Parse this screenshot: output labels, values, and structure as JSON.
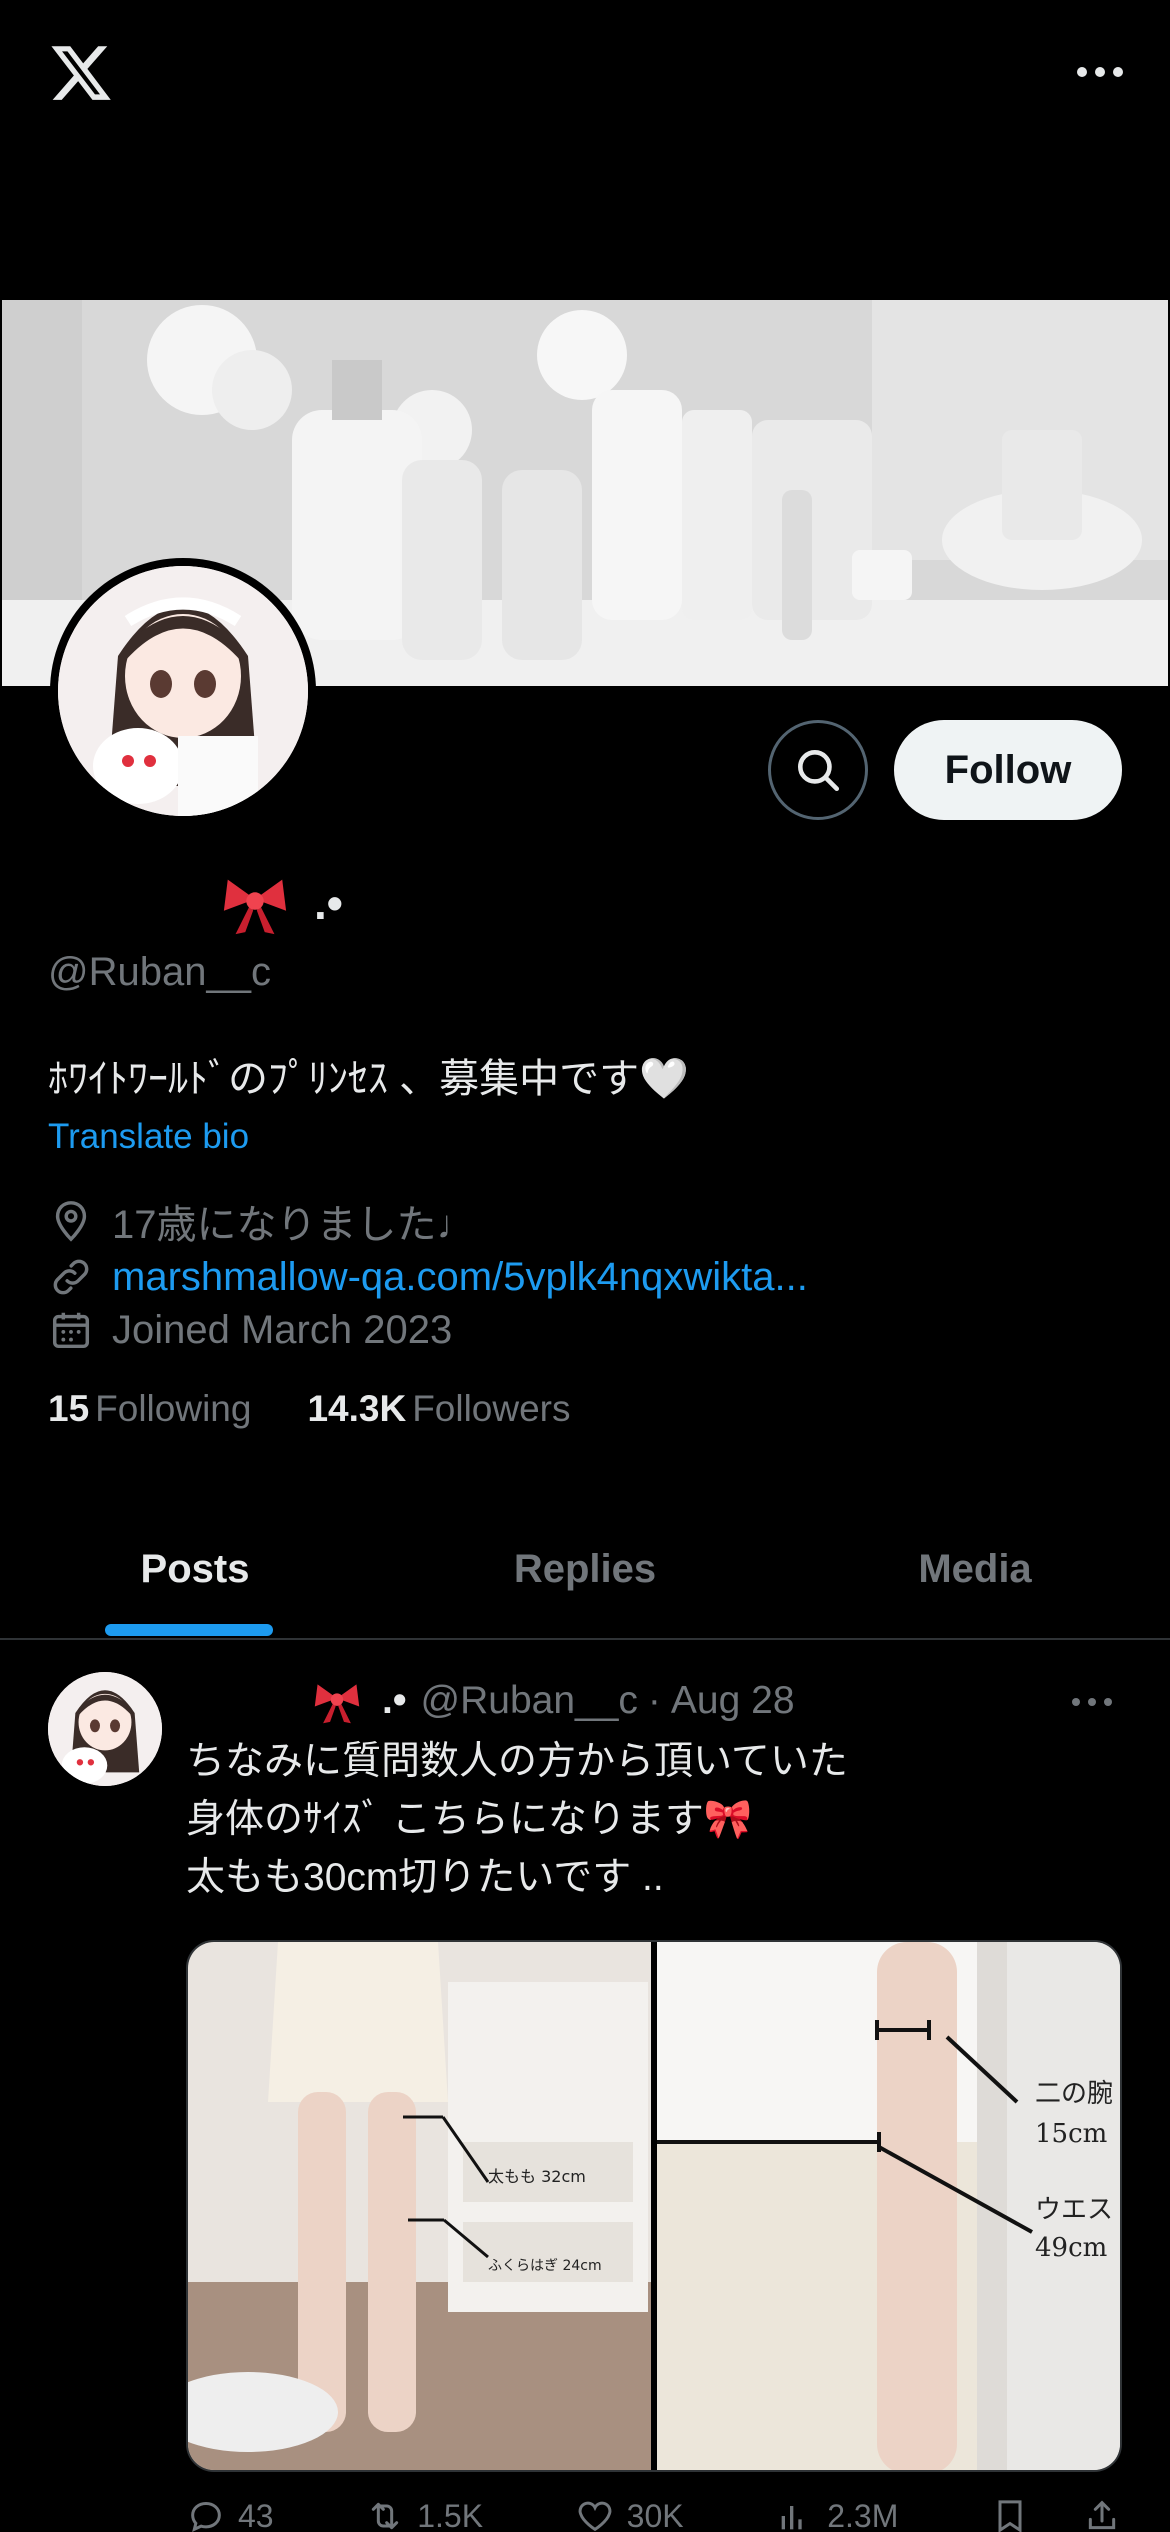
{
  "profile": {
    "name_suffix": ".•",
    "handle": "@Ruban__c",
    "bio": "ﾎﾜｲﾄﾜｰﾙﾄﾞのﾌﾟﾘﾝｾｽ 、募集中です🤍",
    "translate_label": "Translate bio",
    "location": "17歳になりました♩",
    "link": "marshmallow-qa.com/5vplk4nqxwikta...",
    "joined": "Joined March 2023",
    "following_count": "15",
    "following_label": "Following",
    "followers_count": "14.3K",
    "followers_label": "Followers"
  },
  "buttons": {
    "follow": "Follow"
  },
  "tabs": [
    {
      "label": "Posts"
    },
    {
      "label": "Replies"
    },
    {
      "label": "Media"
    }
  ],
  "post": {
    "name_suffix": ".•",
    "handle": "@Ruban__c",
    "separator": "·",
    "date": "Aug 28",
    "lines": [
      "ちなみに質問数人の方から頂いていた",
      "身体のｻｲｽﾞ こちらになります🎀",
      "太もも30cm切りたいです .."
    ],
    "media": {
      "left_labels": [
        "太もも 32cm",
        "ふくらはぎ 24cm"
      ],
      "right_labels": [
        "二の腕",
        "15cm",
        "ウエス",
        "49cm"
      ]
    },
    "actions": {
      "replies": "43",
      "reposts": "1.5K",
      "likes": "30K",
      "views": "2.3M"
    }
  },
  "icons": {
    "logo": "x-logo-icon",
    "more": "more-horizontal-icon",
    "search": "search-icon",
    "location": "location-pin-icon",
    "link": "link-icon",
    "calendar": "calendar-icon",
    "bow": "red-bow-icon",
    "reply": "reply-icon",
    "repost": "repost-icon",
    "like": "heart-icon",
    "views": "views-icon",
    "bookmark": "bookmark-icon",
    "share": "share-icon"
  },
  "colors": {
    "accent": "#1d9bf0",
    "bow": "#e0303e"
  }
}
